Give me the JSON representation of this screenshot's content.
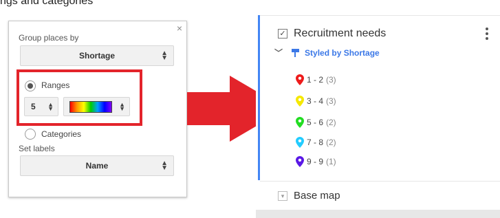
{
  "top_caption": "ngs and categories",
  "dialog": {
    "close": "×",
    "group_label": "Group places by",
    "group_value": "Shortage",
    "ranges_label": "Ranges",
    "ranges_count": "5",
    "categories_label": "Categories",
    "set_labels_label": "Set labels",
    "labels_value": "Name"
  },
  "panel": {
    "layer_title": "Recruitment needs",
    "styled_by": "Styled by Shortage",
    "legend": [
      {
        "range": "1 - 2",
        "count": "(3)",
        "color": "#ee1b1b"
      },
      {
        "range": "3 - 4",
        "count": "(3)",
        "color": "#f5e800"
      },
      {
        "range": "5 - 6",
        "count": "(2)",
        "color": "#22dd22"
      },
      {
        "range": "7 - 8",
        "count": "(2)",
        "color": "#22ccff"
      },
      {
        "range": "9 - 9",
        "count": "(1)",
        "color": "#5a18e6"
      }
    ],
    "base_map": "Base map"
  },
  "colors": {
    "highlight": "#e3242b",
    "arrow": "#e3242b",
    "accent_blue": "#4285f4"
  }
}
